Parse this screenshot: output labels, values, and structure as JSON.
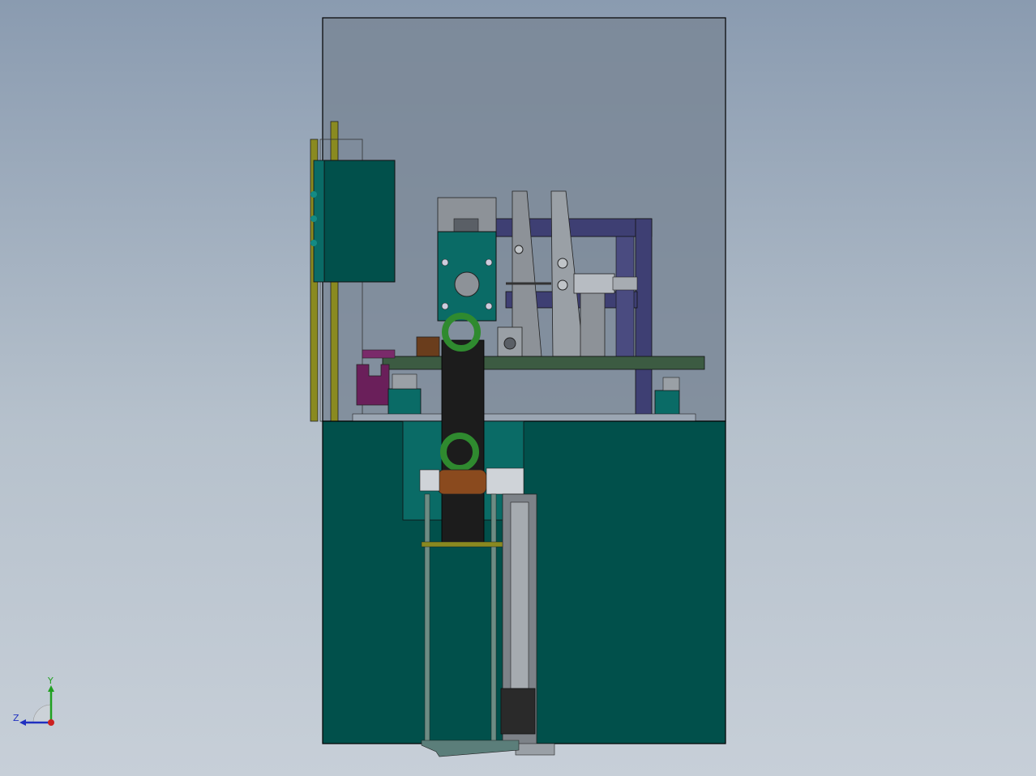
{
  "viewport": {
    "background_top": "#8a9bb0",
    "background_bottom": "#c7cfd8"
  },
  "colors": {
    "teal_body": "#01504b",
    "teal_light": "#0a6b66",
    "glass": "#7b8797",
    "yellow_bar": "#8a8a20",
    "navy_frame": "#3e3f73",
    "plate_green": "#3c5b42",
    "belt_black": "#1c1c1c",
    "ring_green": "#2f8a2f",
    "copper": "#8a4a1e",
    "purple": "#6a1f5a",
    "grey_steel": "#8d9298"
  },
  "triad": {
    "x_axis_color": "#cc2020",
    "y_axis_color": "#20a020",
    "z_axis_color": "#2030c0",
    "labels": {
      "y": "Y",
      "z": "Z"
    }
  }
}
